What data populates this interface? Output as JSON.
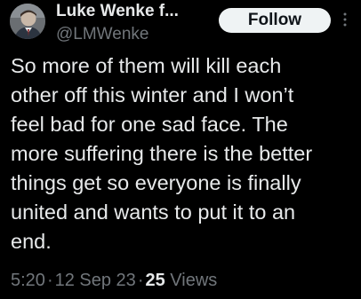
{
  "user": {
    "display_name": "Luke Wenke f...",
    "handle": "@LMWenke"
  },
  "actions": {
    "follow_label": "Follow",
    "more_icon": "more-vertical-icon"
  },
  "tweet": {
    "text": "So more of them will kill each\nother off this winter and I won’t\nfeel bad for one sad face.  The\nmore suffering there is the better\nthings get so everyone is finally\nunited and wants to put it to an\nend."
  },
  "meta": {
    "time": "5:20",
    "separator": "·",
    "date": "12 Sep 23",
    "views_count": "25",
    "views_label": "Views"
  },
  "colors": {
    "background": "#000000",
    "primary_text": "#e7e9ea",
    "secondary_text": "#71767b",
    "follow_bg": "#eff3f4",
    "follow_text": "#0f1419"
  }
}
